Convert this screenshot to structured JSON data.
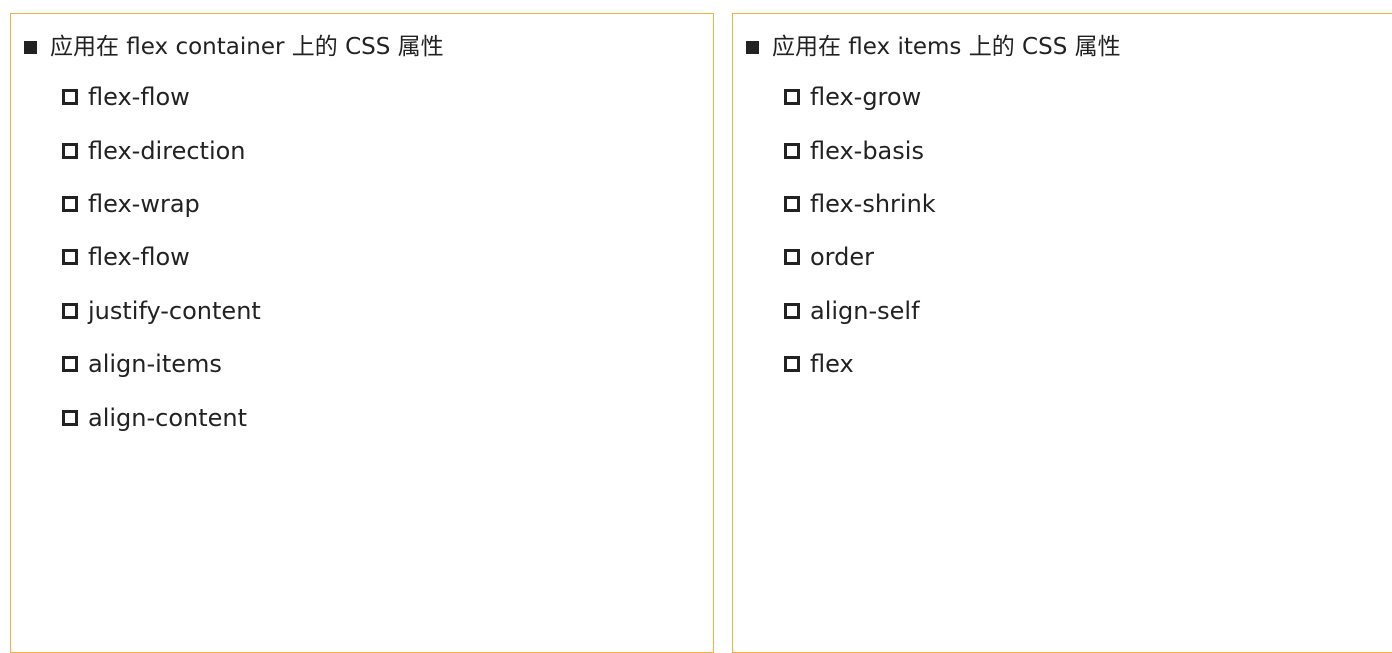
{
  "left_panel": {
    "heading": "应用在 flex container 上的 CSS 属性",
    "items": [
      "flex-flow",
      "flex-direction",
      "flex-wrap",
      "flex-flow",
      "justify-content",
      "align-items",
      "align-content"
    ]
  },
  "right_panel": {
    "heading": "应用在 flex items 上的 CSS 属性",
    "items": [
      "flex-grow",
      "flex-basis",
      "flex-shrink",
      "order",
      "align-self",
      "flex"
    ]
  },
  "colors": {
    "border": "#f5b041",
    "text": "#222222",
    "background": "#ffffff"
  },
  "icons": {
    "heading_bullet": "filled-square-icon",
    "item_bullet": "hollow-square-icon"
  }
}
